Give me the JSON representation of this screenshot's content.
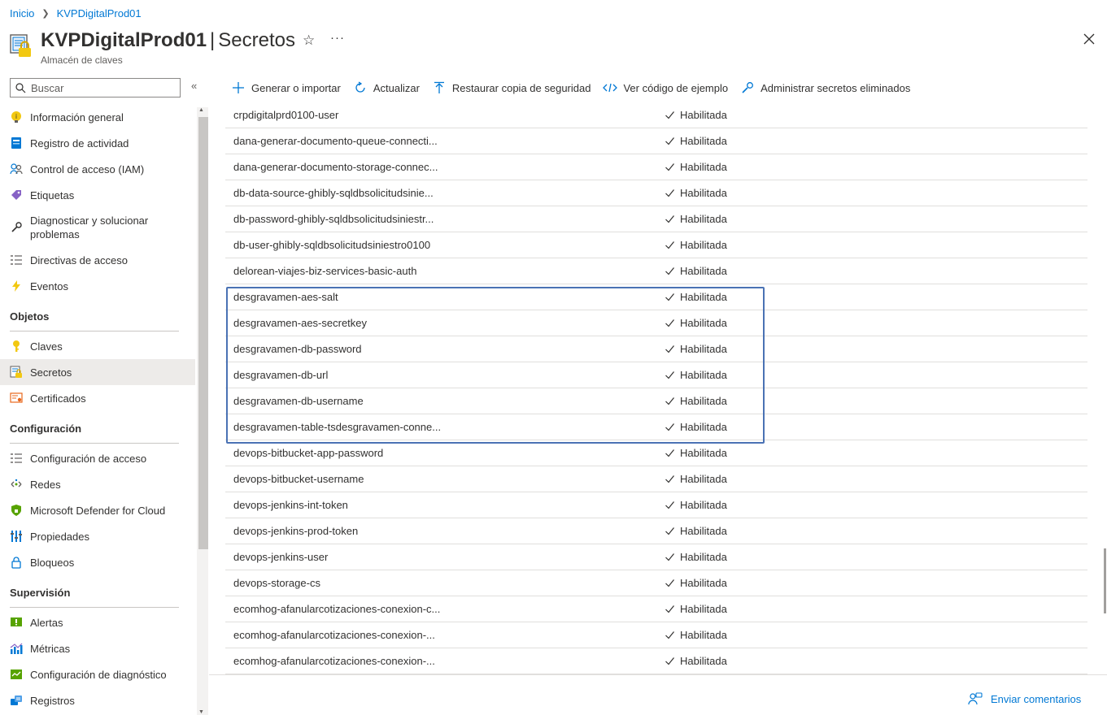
{
  "breadcrumb": {
    "home": "Inicio",
    "current": "KVPDigitalProd01"
  },
  "header": {
    "resource_name": "KVPDigitalProd01",
    "separator": "|",
    "page": "Secretos",
    "subtitle": "Almacén de claves"
  },
  "search": {
    "placeholder": "Buscar"
  },
  "nav": {
    "items_top": [
      {
        "label": "Información general",
        "icon": "info-bulb-icon"
      },
      {
        "label": "Registro de actividad",
        "icon": "activity-log-icon"
      },
      {
        "label": "Control de acceso (IAM)",
        "icon": "people-icon"
      },
      {
        "label": "Etiquetas",
        "icon": "tag-icon"
      },
      {
        "label": "Diagnosticar y solucionar problemas",
        "icon": "wrench-icon"
      },
      {
        "label": "Directivas de acceso",
        "icon": "list-check-icon"
      },
      {
        "label": "Eventos",
        "icon": "lightning-icon"
      }
    ],
    "section_objetos": "Objetos",
    "items_objetos": [
      {
        "label": "Claves",
        "icon": "key-icon"
      },
      {
        "label": "Secretos",
        "icon": "secret-icon"
      },
      {
        "label": "Certificados",
        "icon": "certificate-icon"
      }
    ],
    "section_config": "Configuración",
    "items_config": [
      {
        "label": "Configuración de acceso",
        "icon": "access-config-icon"
      },
      {
        "label": "Redes",
        "icon": "network-icon"
      },
      {
        "label": "Microsoft Defender for Cloud",
        "icon": "shield-icon"
      },
      {
        "label": "Propiedades",
        "icon": "properties-icon"
      },
      {
        "label": "Bloqueos",
        "icon": "lock-icon"
      }
    ],
    "section_supervision": "Supervisión",
    "items_supervision": [
      {
        "label": "Alertas",
        "icon": "alert-icon"
      },
      {
        "label": "Métricas",
        "icon": "metrics-icon"
      },
      {
        "label": "Configuración de diagnóstico",
        "icon": "diagnostic-settings-icon"
      },
      {
        "label": "Registros",
        "icon": "logs-icon"
      }
    ]
  },
  "toolbar": {
    "generate": "Generar o importar",
    "refresh": "Actualizar",
    "restore": "Restaurar copia de seguridad",
    "code": "Ver código de ejemplo",
    "manage_deleted": "Administrar secretos eliminados"
  },
  "secrets": [
    {
      "name": "crpdigitalprd0100-user",
      "status": "Habilitada"
    },
    {
      "name": "dana-generar-documento-queue-connecti...",
      "status": "Habilitada"
    },
    {
      "name": "dana-generar-documento-storage-connec...",
      "status": "Habilitada"
    },
    {
      "name": "db-data-source-ghibly-sqldbsolicitudsinie...",
      "status": "Habilitada"
    },
    {
      "name": "db-password-ghibly-sqldbsolicitudsiniestr...",
      "status": "Habilitada"
    },
    {
      "name": "db-user-ghibly-sqldbsolicitudsiniestro0100",
      "status": "Habilitada"
    },
    {
      "name": "delorean-viajes-biz-services-basic-auth",
      "status": "Habilitada"
    },
    {
      "name": "desgravamen-aes-salt",
      "status": "Habilitada"
    },
    {
      "name": "desgravamen-aes-secretkey",
      "status": "Habilitada"
    },
    {
      "name": "desgravamen-db-password",
      "status": "Habilitada"
    },
    {
      "name": "desgravamen-db-url",
      "status": "Habilitada"
    },
    {
      "name": "desgravamen-db-username",
      "status": "Habilitada"
    },
    {
      "name": "desgravamen-table-tsdesgravamen-conne...",
      "status": "Habilitada"
    },
    {
      "name": "devops-bitbucket-app-password",
      "status": "Habilitada"
    },
    {
      "name": "devops-bitbucket-username",
      "status": "Habilitada"
    },
    {
      "name": "devops-jenkins-int-token",
      "status": "Habilitada"
    },
    {
      "name": "devops-jenkins-prod-token",
      "status": "Habilitada"
    },
    {
      "name": "devops-jenkins-user",
      "status": "Habilitada"
    },
    {
      "name": "devops-storage-cs",
      "status": "Habilitada"
    },
    {
      "name": "ecomhog-afanularcotizaciones-conexion-c...",
      "status": "Habilitada"
    },
    {
      "name": "ecomhog-afanularcotizaciones-conexion-...",
      "status": "Habilitada"
    },
    {
      "name": "ecomhog-afanularcotizaciones-conexion-...",
      "status": "Habilitada"
    }
  ],
  "feedback": "Enviar comentarios",
  "colors": {
    "accent": "#0078d4",
    "highlight_border": "#4a72b4",
    "key_yellow": "#f2c811"
  }
}
